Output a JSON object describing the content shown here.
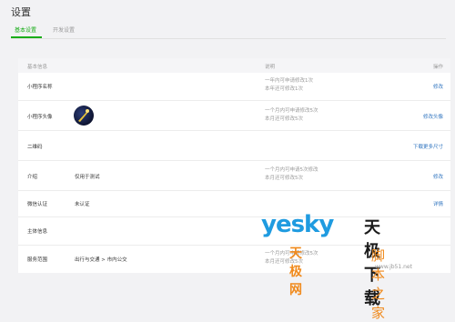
{
  "page": {
    "title": "设置"
  },
  "tabs": [
    {
      "label": "基本设置",
      "active": true
    },
    {
      "label": "开发设置",
      "active": false
    }
  ],
  "table": {
    "headers": {
      "info": "基本信息",
      "desc": "说明",
      "action": "操作"
    },
    "rows": {
      "name": {
        "label": "小程序名称",
        "desc1": "一年内可申请修改1次",
        "desc2": "本年还可修改1次",
        "action": "修改"
      },
      "avatar": {
        "label": "小程序头像",
        "desc1": "一个月内可申请修改5次",
        "desc2": "本月还可修改5次",
        "action": "修改头像"
      },
      "qrcode": {
        "label": "二维码",
        "action": "下载更多尺寸"
      },
      "intro": {
        "label": "介绍",
        "value": "仅用于测试",
        "desc1": "一个月内可申请5次修改",
        "desc2": "本月还可修改5次",
        "action": "修改"
      },
      "verify": {
        "label": "微信认证",
        "value": "未认证",
        "action": "详情"
      },
      "subject": {
        "label": "主体信息"
      },
      "scope": {
        "label": "服务范围",
        "value": "出行与交通 > 市内公交",
        "desc1": "一个月内可申请修改5次",
        "desc2": "本月还可修改5次"
      }
    }
  },
  "watermark": {
    "yesky": "yesky",
    "tjdown": "天极下载",
    "tjw": "天极网",
    "jbzj": "脚本之家",
    "site": "www.jb51.net"
  },
  "colors": {
    "accent": "#1aad19",
    "link": "#3276c0",
    "muted": "#9a9a9a",
    "watermark_blue": "#1f9be0",
    "watermark_orange": "#f08a1c"
  }
}
